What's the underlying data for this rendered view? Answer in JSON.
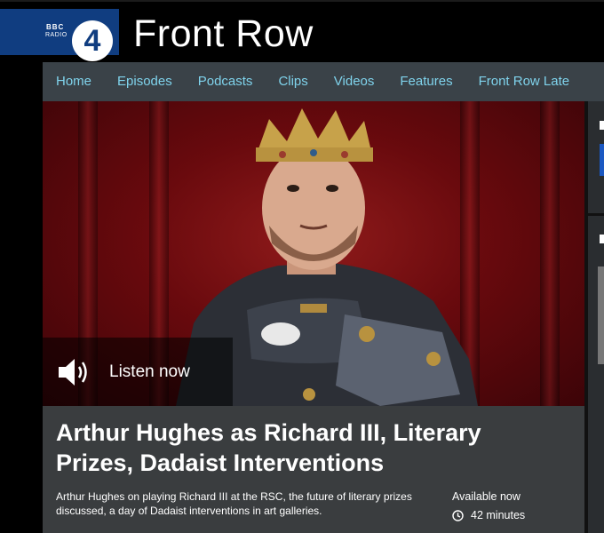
{
  "brand": {
    "bbc": "BBC",
    "radio": "RADIO",
    "number": "4",
    "show_title": "Front Row",
    "colors": {
      "brand_blue": "#103d80",
      "nav_bg": "#3a4248",
      "nav_link": "#7fd3ec",
      "content_bg": "#3a3d3f"
    }
  },
  "nav": {
    "items": [
      {
        "label": "Home"
      },
      {
        "label": "Episodes"
      },
      {
        "label": "Podcasts"
      },
      {
        "label": "Clips"
      },
      {
        "label": "Videos"
      },
      {
        "label": "Features"
      },
      {
        "label": "Front Row Late"
      }
    ]
  },
  "hero": {
    "listen_label": "Listen now",
    "icon": "speaker-icon"
  },
  "episode": {
    "title": "Arthur Hughes as Richard III, Literary Prizes, Dadaist Interventions",
    "description": "Arthur Hughes on playing Richard III at the RSC, the future of literary prizes discussed, a day of Dadaist interventions in art galleries.",
    "availability": "Available now",
    "duration": "42 minutes",
    "duration_icon": "clock-icon"
  }
}
